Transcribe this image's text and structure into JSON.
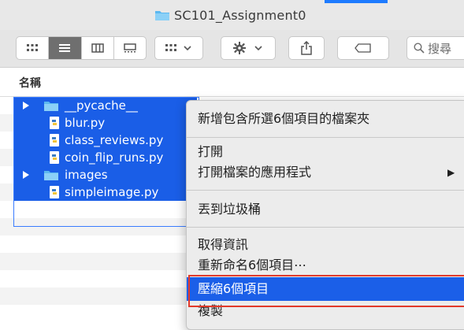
{
  "window": {
    "title": "SC101_Assignment0"
  },
  "toolbar": {
    "view_modes": [
      "icon-view-icon",
      "list-view-icon",
      "column-view-icon",
      "gallery-view-icon"
    ],
    "search_placeholder": "搜尋"
  },
  "list": {
    "column_name": "名稱",
    "items": [
      {
        "name": "__pycache__",
        "type": "folder"
      },
      {
        "name": "blur.py",
        "type": "python"
      },
      {
        "name": "class_reviews.py",
        "type": "python"
      },
      {
        "name": "coin_flip_runs.py",
        "type": "python"
      },
      {
        "name": "images",
        "type": "folder"
      },
      {
        "name": "simpleimage.py",
        "type": "python"
      }
    ]
  },
  "context_menu": {
    "items": [
      "新增包含所選6個項目的檔案夾",
      "打開",
      "打開檔案的應用程式",
      "丟到垃圾桶",
      "取得資訊",
      "重新命名6個項目⋯",
      "壓縮6個項目",
      "複製"
    ]
  },
  "colors": {
    "selection": "#1a5ee7",
    "highlight_frame": "#e23a2b",
    "accent": "#1e7bff"
  }
}
